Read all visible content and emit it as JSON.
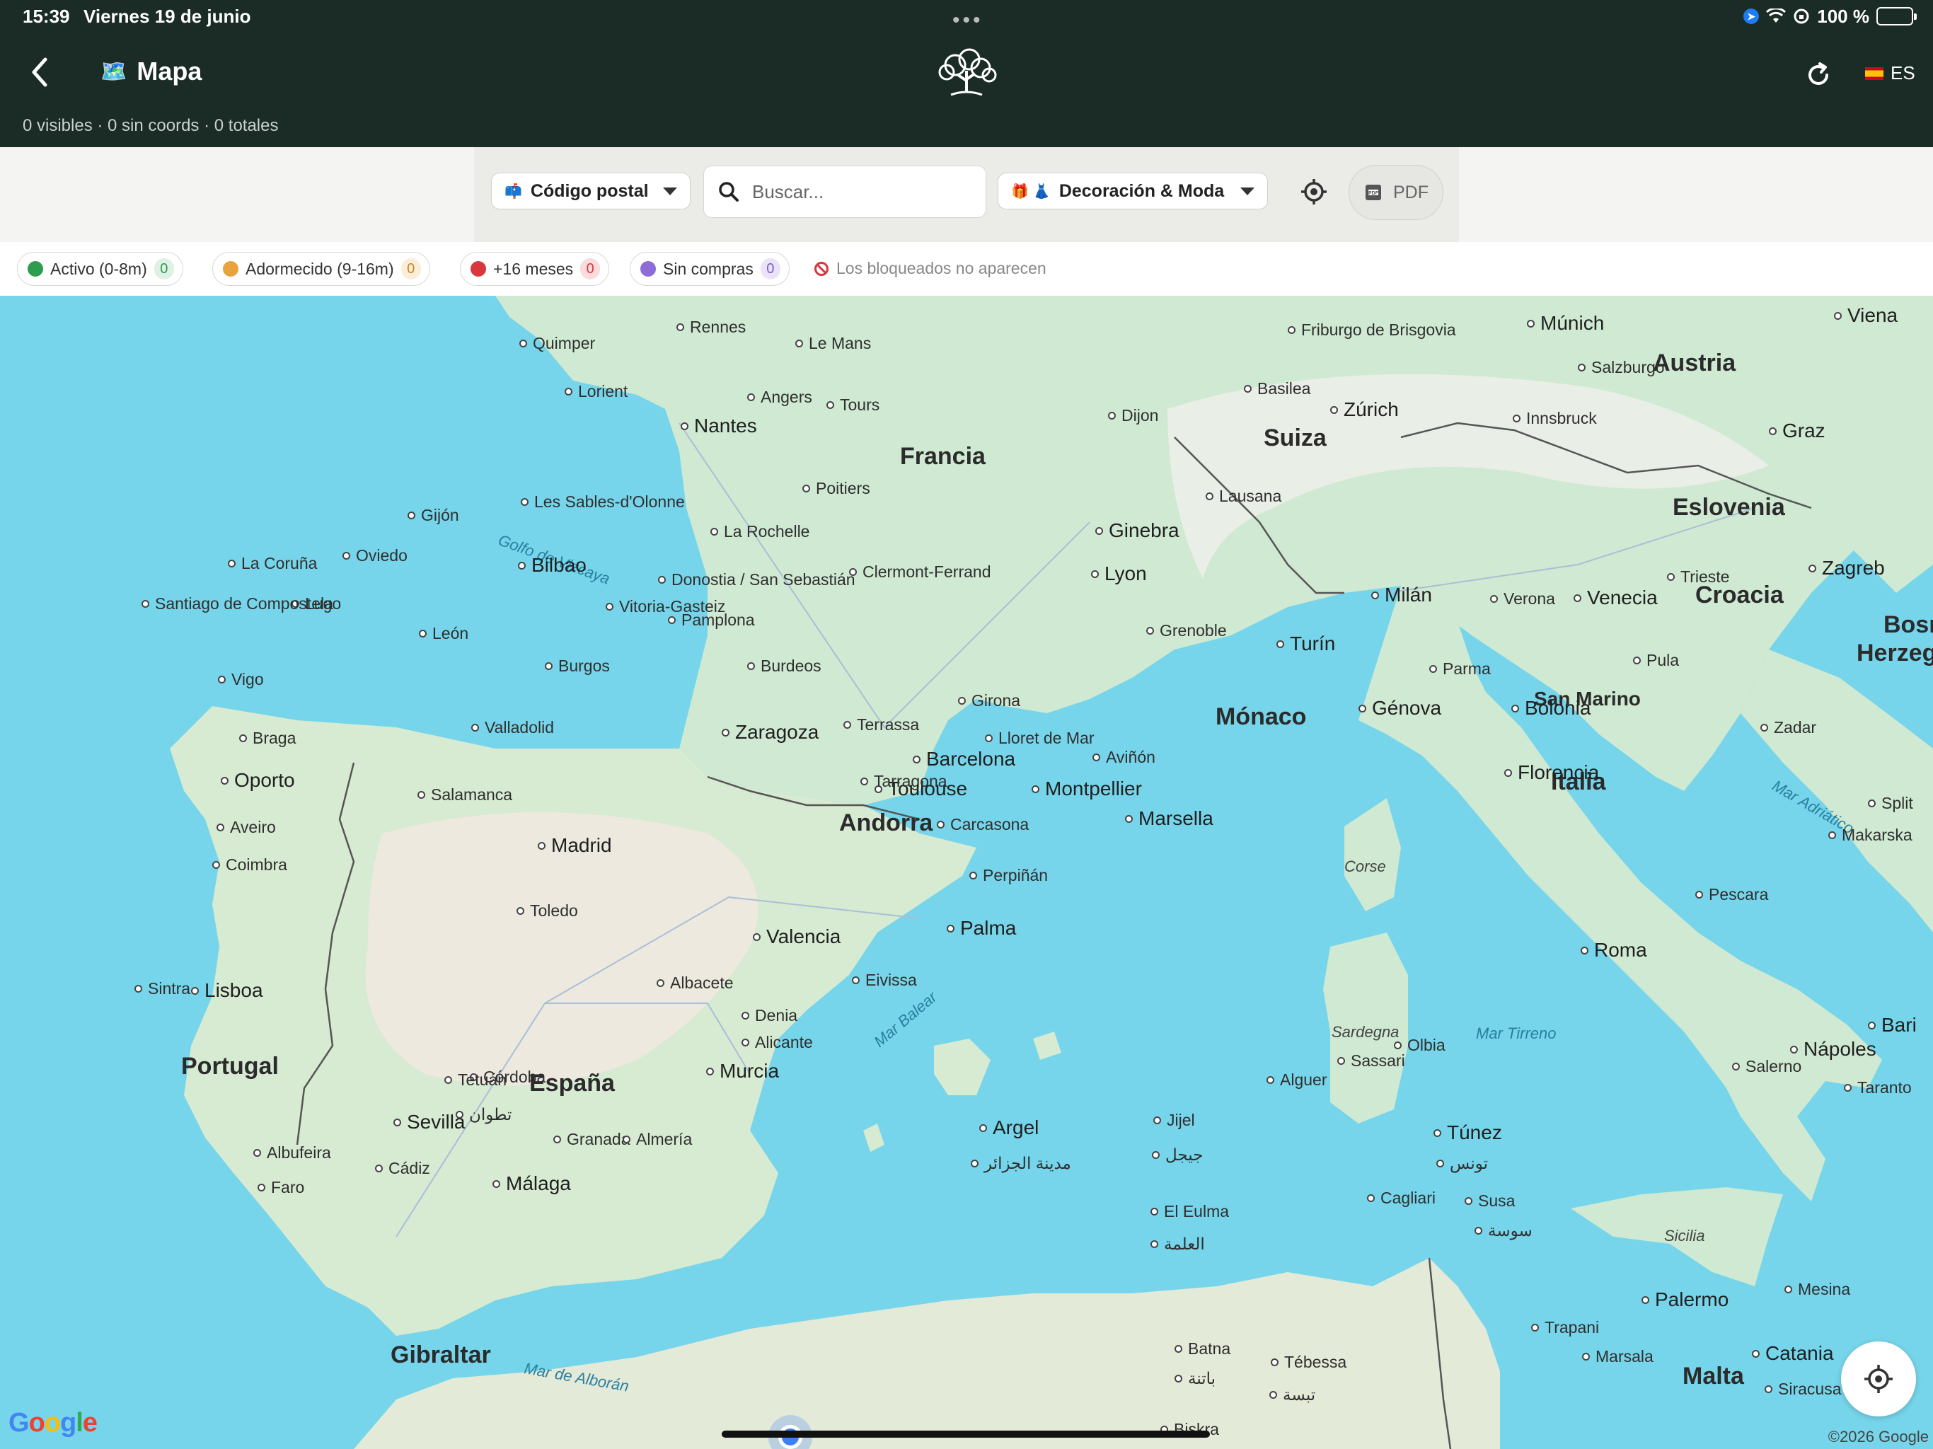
{
  "status_bar": {
    "time": "15:39",
    "date": "Viernes 19 de junio",
    "battery": "100 %"
  },
  "header": {
    "title": "Mapa",
    "title_icon": "map-emoji",
    "lang": "ES",
    "counts": "0 visibles · 0 sin coords · 0 totales"
  },
  "toolbar": {
    "postal_dropdown": "Código postal",
    "search_placeholder": "Buscar...",
    "category_dropdown": "Decoración & Moda",
    "pdf_label": "PDF"
  },
  "legend": {
    "chips": [
      {
        "label": "Activo (0-8m)",
        "count": "0",
        "color": "#2e9c4f",
        "badge_bg": "#dff1e4",
        "badge_fg": "#2e9c4f"
      },
      {
        "label": "Adormecido (9-16m)",
        "count": "0",
        "color": "#e8a33d",
        "badge_bg": "#fbeed8",
        "badge_fg": "#c8842a"
      },
      {
        "label": "+16 meses",
        "count": "0",
        "color": "#d9363e",
        "badge_bg": "#fadcdc",
        "badge_fg": "#d9363e"
      },
      {
        "label": "Sin compras",
        "count": "0",
        "color": "#8e6bd6",
        "badge_bg": "#ebe4f8",
        "badge_fg": "#7a5bc8"
      }
    ],
    "note": "Los bloqueados no aparecen"
  },
  "map": {
    "countries": [
      "Francia",
      "Suiza",
      "Austria",
      "Eslovenia",
      "Croacia",
      "Bosn",
      "Herzeg",
      "Italia",
      "Mónaco",
      "San Marino",
      "Andorra",
      "Portugal",
      "España",
      "Gibraltar",
      "Malta"
    ],
    "seas": [
      "Golfo de Vizcaya",
      "Mar Balear",
      "Mar Tirreno",
      "Mar Adriático",
      "Mar de Alborán"
    ],
    "islands": [
      "Corse",
      "Sardegna",
      "Sicilia"
    ],
    "cities": [
      "Quimper",
      "Lorient",
      "Rennes",
      "Le Mans",
      "Nantes",
      "Angers",
      "Tours",
      "Les Sables-d'Olonne",
      "Poitiers",
      "La Rochelle",
      "Burdeos",
      "Clermont-Ferrand",
      "Lyon",
      "Dijon",
      "Ginebra",
      "Grenoble",
      "Aviñón",
      "Montpellier",
      "Marsella",
      "Toulouse",
      "Carcasona",
      "Perpiñán",
      "Friburgo de Brisgovia",
      "Basilea",
      "Zúrich",
      "Lausana",
      "Múnich",
      "Salzburgo",
      "Innsbruck",
      "Viena",
      "Graz",
      "Zagreb",
      "Trieste",
      "Verona",
      "Venecia",
      "Milán",
      "Turín",
      "Parma",
      "Génova",
      "Bolonia",
      "Florencia",
      "Pula",
      "Zadar",
      "Split",
      "Makarska",
      "Pescara",
      "Roma",
      "Nápoles",
      "Salerno",
      "Bari",
      "Taranto",
      "Olbia",
      "Sassari",
      "Alguer",
      "Cagliari",
      "Palermo",
      "Trapani",
      "Marsala",
      "Mesina",
      "Catania",
      "Siracusa",
      "Túnez",
      "تونس",
      "Susa",
      "سوسة",
      "Argel",
      "مدينة الجزائر",
      "Jijel",
      "جيجل",
      "El Eulma",
      "العلمة",
      "Batna",
      "باتنة",
      "Tébessa",
      "تبسة",
      "Biskra",
      "Gijón",
      "Oviedo",
      "La Coruña",
      "Lugo",
      "Santiago de Compostela",
      "Vigo",
      "Braga",
      "Oporto",
      "Aveiro",
      "Coimbra",
      "León",
      "Burgos",
      "Bilbao",
      "Donostia / San Sebastián",
      "Vitoria-Gasteiz",
      "Pamplona",
      "Valladolid",
      "Salamanca",
      "Zaragoza",
      "Terrassa",
      "Girona",
      "Lloret de Mar",
      "Barcelona",
      "Tarragona",
      "Madrid",
      "Toledo",
      "Valencia",
      "Albacete",
      "Denia",
      "Eivissa",
      "Palma",
      "Alicante",
      "Murcia",
      "Córdoba",
      "Sevilla",
      "Granada",
      "Almería",
      "Málaga",
      "Cádiz",
      "Albufeira",
      "Faro",
      "Sintra",
      "Lisboa",
      "Tetuán",
      "تطوان"
    ],
    "attribution": "©2026 Google",
    "provider_logo": "Google"
  }
}
